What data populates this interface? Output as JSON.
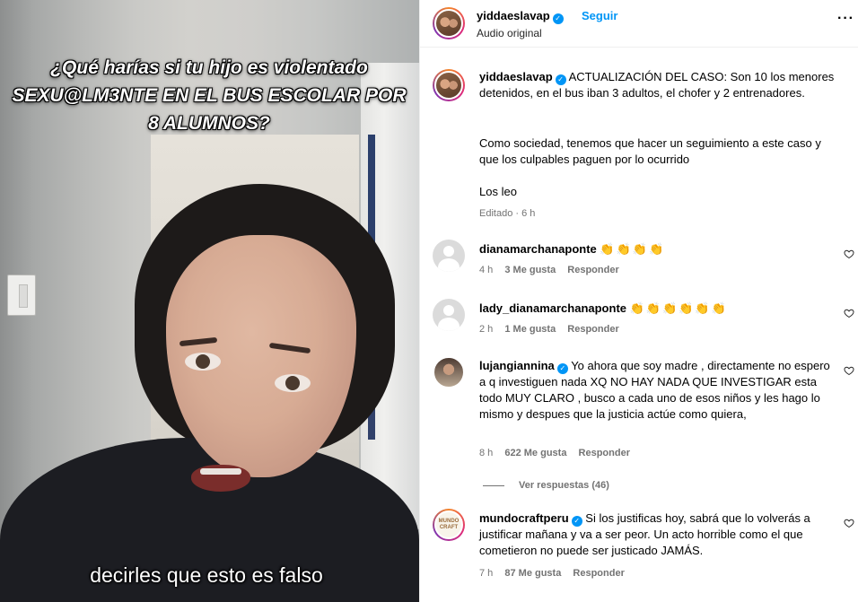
{
  "video": {
    "overlay_title": "¿Qué harías si tu hijo es violentado SEXU@LM3NTE EN EL BUS ESCOLAR POR 8 ALUMNOS?",
    "caption": "decirles que esto es falso"
  },
  "header": {
    "username": "yiddaeslavap",
    "follow_label": "Seguir",
    "audio": "Audio original",
    "more_icon": "more-horizontal-icon"
  },
  "post": {
    "username": "yiddaeslavap",
    "text_p1": "ACTUALIZACIÓN DEL CASO: Son 10 los menores detenidos, en el bus iban 3 adultos, el chofer y 2 entrenadores.",
    "text_p2": "Como sociedad, tenemos que hacer un seguimiento a este caso y que los culpables paguen por lo ocurrido",
    "text_p3": "Los leo",
    "meta": "Editado · 6 h"
  },
  "comments": [
    {
      "username": "dianamarchanaponte",
      "text": "👏👏👏👏",
      "time": "4 h",
      "likes": "3 Me gusta",
      "reply": "Responder",
      "verified": false
    },
    {
      "username": "lady_dianamarchanaponte",
      "text": "👏👏👏👏👏👏",
      "time": "2 h",
      "likes": "1 Me gusta",
      "reply": "Responder",
      "verified": false
    },
    {
      "username": "lujangiannina",
      "text": "Yo ahora que soy madre , directamente no espero a q investiguen nada XQ NO HAY NADA QUE INVESTIGAR esta todo MUY CLARO , busco a cada uno de esos niños y les hago lo mismo y despues que la justicia actúe como quiera,",
      "time": "8 h",
      "likes": "622 Me gusta",
      "reply": "Responder",
      "verified": true,
      "view_replies": "Ver respuestas (46)"
    },
    {
      "username": "mundocraftperu",
      "text": "Si los justificas hoy, sabrá que lo volverás a justificar mañana y va a ser peor. Un acto horrible como el que cometieron no puede ser justicado JAMÁS.",
      "time": "7 h",
      "likes": "87 Me gusta",
      "reply": "Responder",
      "verified": true,
      "avatar_text": "MUNDO CRAFT"
    }
  ],
  "colors": {
    "accent": "#0095f6",
    "muted": "#737373"
  }
}
